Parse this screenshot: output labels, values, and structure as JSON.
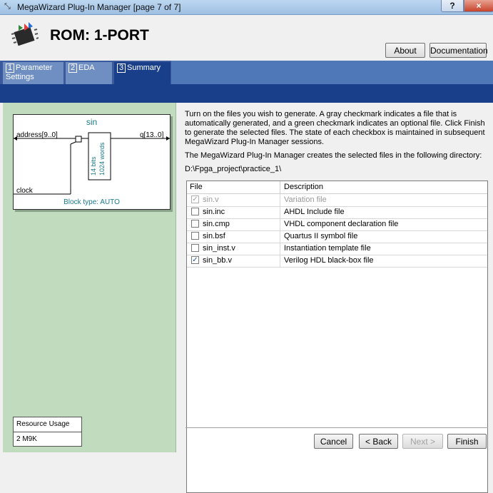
{
  "window": {
    "title": "MegaWizard Plug-In Manager [page 7 of 7]",
    "help_label": "?",
    "close_label": "×"
  },
  "header": {
    "heading": "ROM: 1-PORT",
    "about_label": "About",
    "documentation_label": "Documentation"
  },
  "tabs": [
    {
      "num": "1",
      "label": "Parameter Settings"
    },
    {
      "num": "2",
      "label": "EDA"
    },
    {
      "num": "3",
      "label": "Summary"
    }
  ],
  "symbol": {
    "name": "sin",
    "address_port": "address[9..0]",
    "q_port": "q[13..0]",
    "clock_port": "clock",
    "bits_label": "14 bits",
    "words_label": "1024 words",
    "block_type": "Block type: AUTO"
  },
  "resource": {
    "header": "Resource Usage",
    "value": "2 M9K"
  },
  "info": {
    "intro": "Turn on the files you wish to generate. A gray checkmark indicates a file that is automatically generated, and a green checkmark indicates an optional file. Click Finish to generate the selected files. The state of each checkbox is maintained in subsequent MegaWizard Plug-In Manager sessions.",
    "directory_note": "The MegaWizard Plug-In Manager creates the selected files in the following directory:",
    "directory": "D:\\Fpga_project\\practice_1\\"
  },
  "file_table": {
    "col_file": "File",
    "col_description": "Description",
    "rows": [
      {
        "file": "sin.v",
        "description": "Variation file",
        "checked": true,
        "disabled": true
      },
      {
        "file": "sin.inc",
        "description": "AHDL Include file",
        "checked": false,
        "disabled": false
      },
      {
        "file": "sin.cmp",
        "description": "VHDL component declaration file",
        "checked": false,
        "disabled": false
      },
      {
        "file": "sin.bsf",
        "description": "Quartus II symbol file",
        "checked": false,
        "disabled": false
      },
      {
        "file": "sin_inst.v",
        "description": "Instantiation template file",
        "checked": false,
        "disabled": false
      },
      {
        "file": "sin_bb.v",
        "description": "Verilog HDL black-box file",
        "checked": true,
        "disabled": false
      }
    ]
  },
  "buttons": {
    "cancel": "Cancel",
    "back": "< Back",
    "next": "Next >",
    "finish": "Finish"
  }
}
